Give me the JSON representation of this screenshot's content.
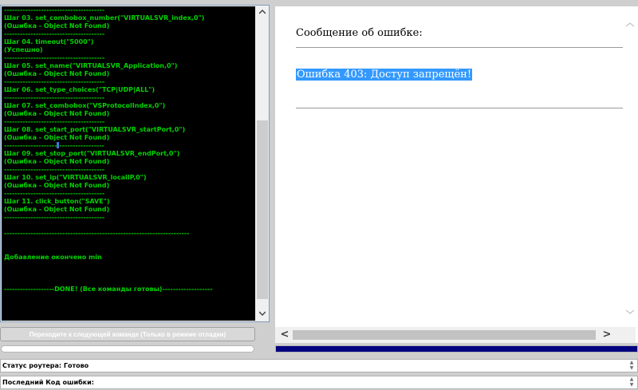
{
  "log": {
    "lines": [
      {
        "type": "sep",
        "text": "--------------------------------------"
      },
      {
        "type": "text",
        "text": "Шаг 03. set_combobox_number(\"VIRTUALSVR_index,0\")"
      },
      {
        "type": "text",
        "text": "(Ошибка - Object Not Found)"
      },
      {
        "type": "sep",
        "text": "--------------------------------------"
      },
      {
        "type": "text",
        "text": "Шаг 04. timeout(\"5000\")"
      },
      {
        "type": "text",
        "text": "(Успешно)"
      },
      {
        "type": "sep",
        "text": "--------------------------------------"
      },
      {
        "type": "text",
        "text": "Шаг 05. set_name(\"VIRTUALSVR_Application,0\")"
      },
      {
        "type": "text",
        "text": "(Ошибка - Object Not Found)"
      },
      {
        "type": "sep",
        "text": "--------------------------------------"
      },
      {
        "type": "text",
        "text": "Шаг 06. set_type_choices(\"TCP|UDP|ALL\")"
      },
      {
        "type": "sep",
        "text": "--------------------------------------"
      },
      {
        "type": "text",
        "text": "Шаг 07. set_combobox(\"VSProtocolIndex,0\")"
      },
      {
        "type": "text",
        "text": "(Ошибка - Object Not Found)"
      },
      {
        "type": "sep",
        "text": "--------------------------------------"
      },
      {
        "type": "text",
        "text": "Шаг 08. set_start_port(\"VIRTUALSVR_startPort,0\")"
      },
      {
        "type": "text",
        "text": "(Ошибка - Object Not Found)"
      },
      {
        "type": "sepcursor",
        "text": "--------------------",
        "text2": "-----------------"
      },
      {
        "type": "text",
        "text": "Шаг 09. set_stop_port(\"VIRTUALSVR_endPort,0\")"
      },
      {
        "type": "text",
        "text": "(Ошибка - Object Not Found)"
      },
      {
        "type": "sep",
        "text": "--------------------------------------"
      },
      {
        "type": "text",
        "text": "Шаг 10. set_ip(\"VIRTUALSVR_localIP,0\")"
      },
      {
        "type": "text",
        "text": "(Ошибка - Object Not Found)"
      },
      {
        "type": "sep",
        "text": "--------------------------------------"
      },
      {
        "type": "text",
        "text": "Шаг 11. click_button(\"SAVE\")"
      },
      {
        "type": "text",
        "text": "(Ошибка - Object Not Found)"
      },
      {
        "type": "sep",
        "text": "--------------------------------------"
      },
      {
        "type": "gap",
        "text": ""
      },
      {
        "type": "sep",
        "text": "----------------------------------------------------------------------"
      },
      {
        "type": "gap",
        "text": ""
      },
      {
        "type": "gap",
        "text": ""
      },
      {
        "type": "text",
        "text": "Добавление окончено min"
      },
      {
        "type": "gap",
        "text": ""
      },
      {
        "type": "gap",
        "text": ""
      },
      {
        "type": "gap",
        "text": ""
      },
      {
        "type": "text",
        "text": "-------------------DONE! (Все команды готовы)-------------------"
      }
    ]
  },
  "next_command_button": {
    "label": "Переходите к следующей команде (Только в режиме отладки)"
  },
  "message": {
    "title": "Сообщение об ошибке:",
    "error_text": "Ошибка 403: Доступ запрещён!"
  },
  "status": {
    "router_label": "Статус роутера: Готово",
    "last_error_label": "Последний Код ошибки:"
  },
  "icons": {
    "scroll_up": "▲",
    "scroll_down": "▼",
    "scroll_left": "<",
    "scroll_right": ">"
  },
  "colors": {
    "log_background": "#000000",
    "log_text": "#00d200",
    "selection": "#3399ff",
    "progress_fill": "#000080"
  }
}
